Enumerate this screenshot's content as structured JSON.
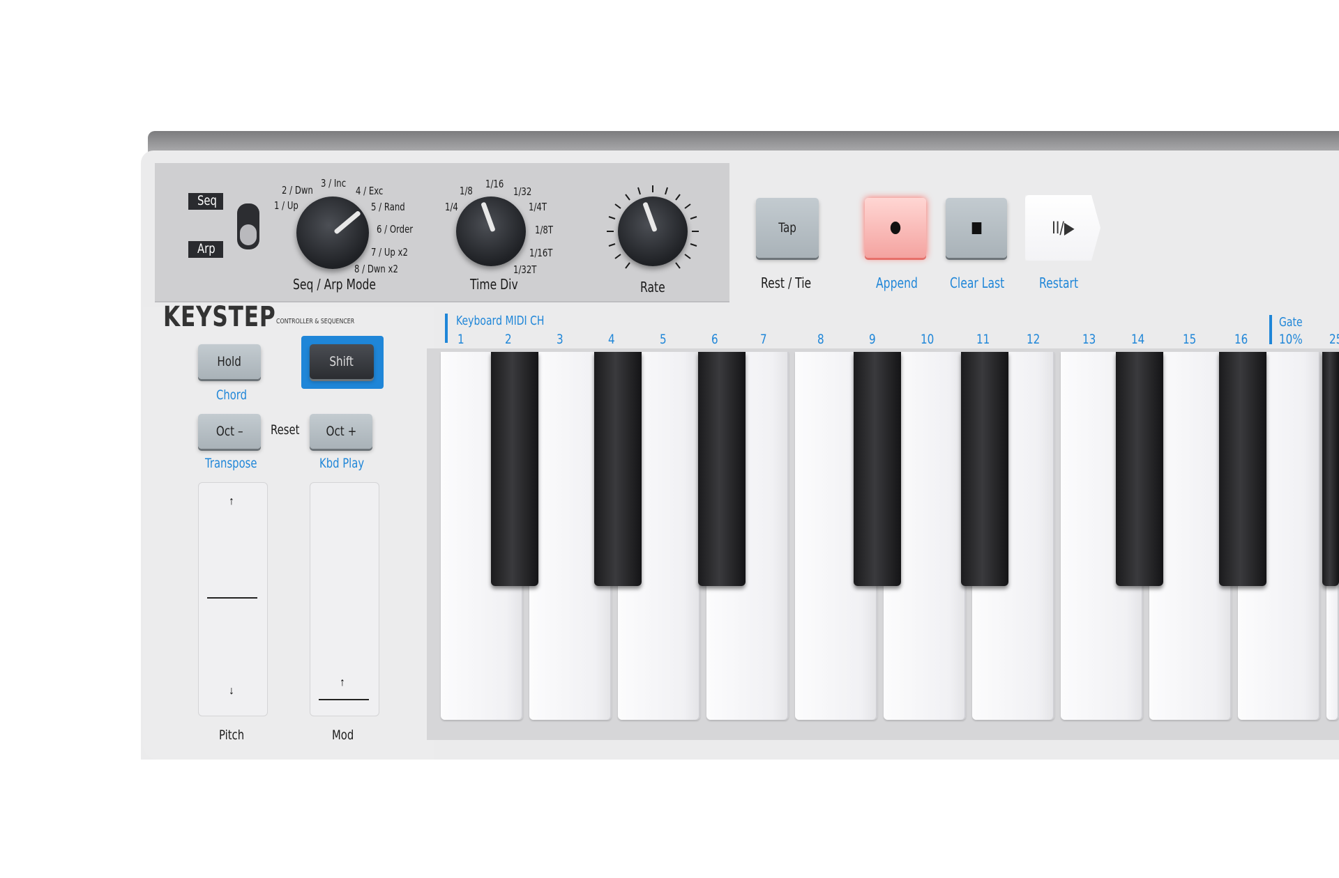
{
  "brand": {
    "name": "KEYSTEP",
    "subtitle": "CONTROLLER & SEQUENCER"
  },
  "switch": {
    "top_label": "Seq",
    "bottom_label": "Arp"
  },
  "mode_knob": {
    "label": "Seq / Arp Mode",
    "positions": [
      "1 / Up",
      "2 / Dwn",
      "3 / Inc",
      "4 / Exc",
      "5 / Rand",
      "6 / Order",
      "7 / Up x2",
      "8 / Dwn x2"
    ]
  },
  "timediv_knob": {
    "label": "Time Div",
    "positions": [
      "1/4",
      "1/8",
      "1/16",
      "1/32",
      "1/4T",
      "1/8T",
      "1/16T",
      "1/32T"
    ]
  },
  "rate_knob": {
    "label": "Rate"
  },
  "transport": {
    "tap": {
      "label": "Tap",
      "caption": "Rest / Tie"
    },
    "record": {
      "caption": "Append",
      "color": "#f4a3a0"
    },
    "stop": {
      "caption": "Clear Last"
    },
    "play": {
      "label": "II/▶",
      "caption": "Restart"
    }
  },
  "left_controls": {
    "hold": {
      "label": "Hold",
      "caption": "Chord"
    },
    "shift": {
      "label": "Shift",
      "accent": "#1f86d8"
    },
    "oct_minus": {
      "label": "Oct –",
      "caption": "Transpose"
    },
    "reset": "Reset",
    "oct_plus": {
      "label": "Oct +",
      "caption": "Kbd Play"
    },
    "pitch": {
      "label": "Pitch"
    },
    "mod": {
      "label": "Mod"
    }
  },
  "keyboard": {
    "midi_ch_label": "Keyboard MIDI CH",
    "channels": [
      "1",
      "2",
      "3",
      "4",
      "5",
      "6",
      "7",
      "8",
      "9",
      "10",
      "11",
      "12",
      "13",
      "14",
      "15",
      "16"
    ],
    "gate_label": "Gate",
    "gate_values": [
      "10%",
      "25"
    ]
  },
  "colors": {
    "accent": "#1f86d8",
    "body": "#ebebec",
    "panel": "#cfcfd1"
  }
}
